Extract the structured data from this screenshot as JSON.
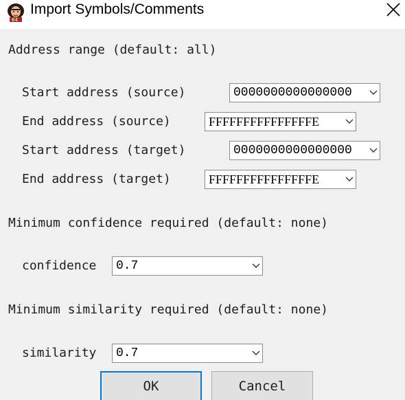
{
  "window": {
    "title": "Import Symbols/Comments",
    "icon": "avatar-app-icon",
    "close_icon": "close-icon"
  },
  "address_range": {
    "heading": "Address range (default: all)",
    "rows": [
      {
        "label": "Start address (source)",
        "value": "0000000000000000"
      },
      {
        "label": "End address (source)",
        "value": "FFFFFFFFFFFFFFFE"
      },
      {
        "label": "Start address (target)",
        "value": "0000000000000000"
      },
      {
        "label": "End address (target)",
        "value": "FFFFFFFFFFFFFFFE"
      }
    ]
  },
  "confidence": {
    "heading": "Minimum confidence required (default: none)",
    "label": "confidence",
    "value": "0.7"
  },
  "similarity": {
    "heading": "Minimum similarity required (default: none)",
    "label": "similarity",
    "value": "0.7"
  },
  "buttons": {
    "ok": "OK",
    "cancel": "Cancel"
  },
  "colors": {
    "dialog_bg": "#f0f0f0",
    "titlebar_bg": "#ffffff",
    "default_button_border": "#0078d7",
    "button_bg": "#e1e1e1"
  }
}
